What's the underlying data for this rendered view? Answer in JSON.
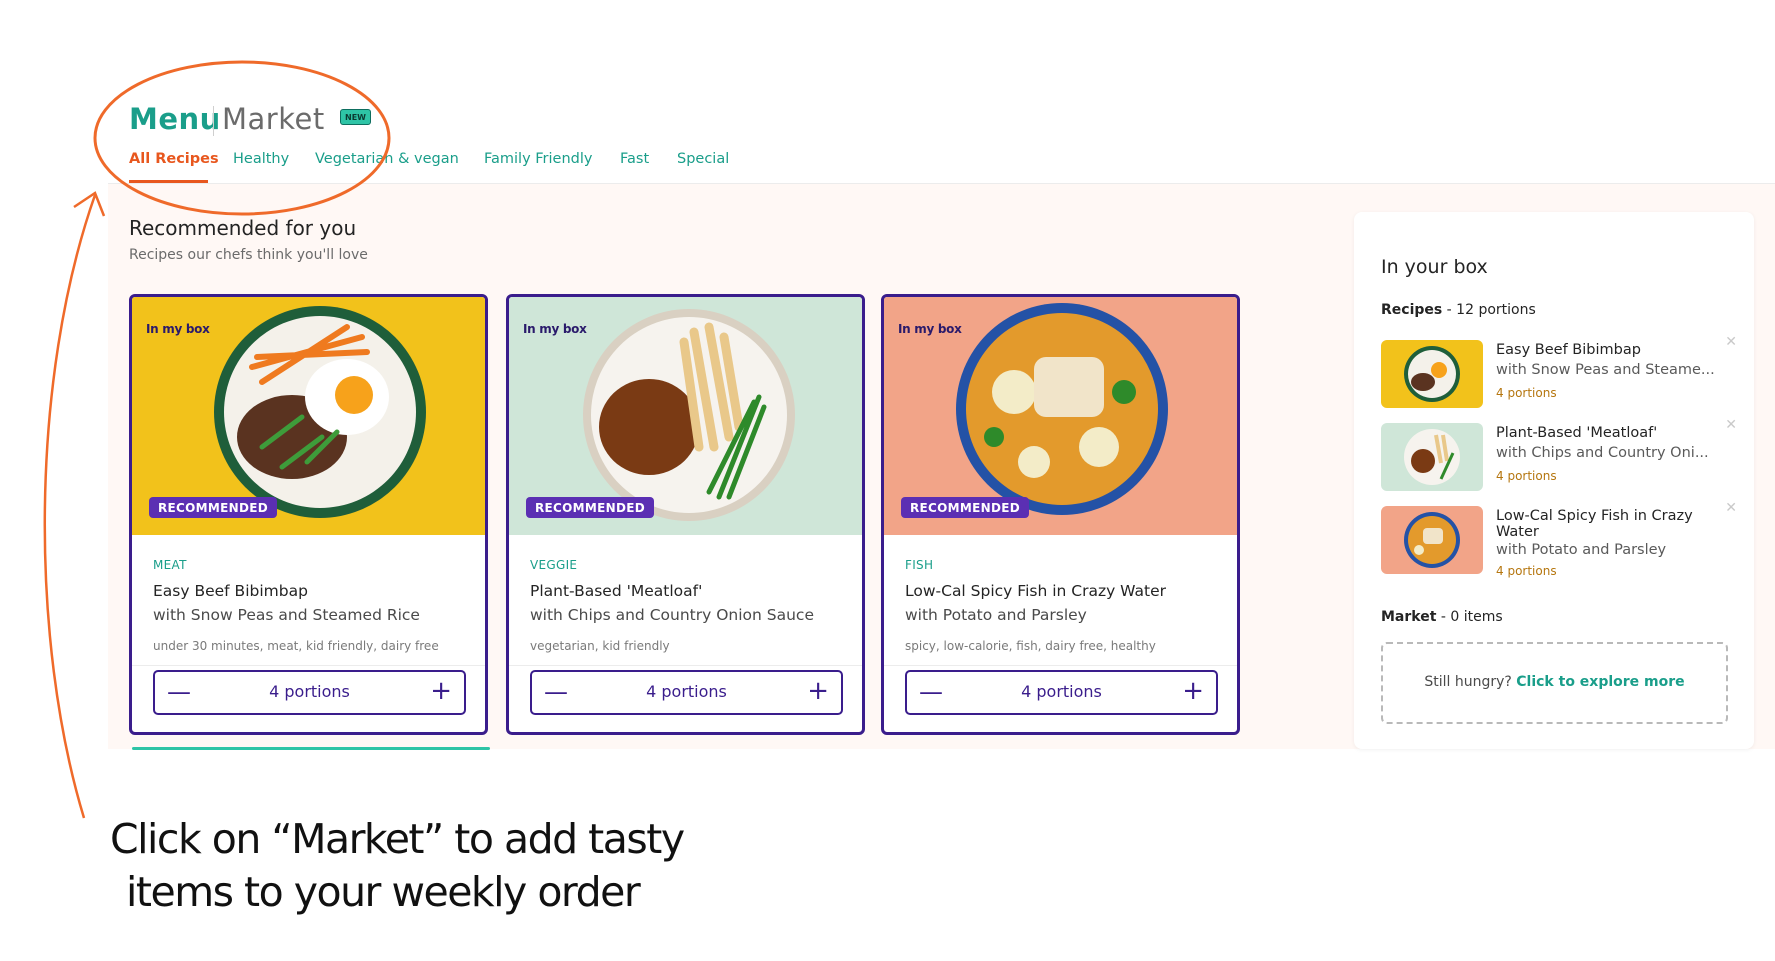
{
  "header": {
    "menu_label": "Menu",
    "market_label": "Market",
    "new_badge": "NEW",
    "tabs": [
      "All Recipes",
      "Healthy",
      "Vegetarian & vegan",
      "Family Friendly",
      "Fast",
      "Special"
    ],
    "active_tab": "All Recipes"
  },
  "recommended": {
    "title": "Recommended for you",
    "subtitle": "Recipes our chefs think you'll love",
    "cards": [
      {
        "in_my_box": "In my box",
        "badge": "RECOMMENDED",
        "category": "MEAT",
        "name": "Easy Beef Bibimbap",
        "subname": "with Snow Peas and Steamed Rice",
        "tags": "under 30 minutes, meat, kid friendly, dairy free",
        "portions": "4 portions",
        "image_bg": "#f2c21b"
      },
      {
        "in_my_box": "In my box",
        "badge": "RECOMMENDED",
        "category": "VEGGIE",
        "name": "Plant-Based 'Meatloaf'",
        "subname": "with Chips and Country Onion Sauce",
        "tags": "vegetarian, kid friendly",
        "portions": "4 portions",
        "image_bg": "#cfe6d8"
      },
      {
        "in_my_box": "In my box",
        "badge": "RECOMMENDED",
        "category": "FISH",
        "name": "Low-Cal Spicy Fish in Crazy Water",
        "subname": "with Potato and Parsley",
        "tags": "spicy, low-calorie, fish, dairy free, healthy",
        "portions": "4 portions",
        "image_bg": "#f2a488"
      }
    ]
  },
  "sidebar": {
    "title": "In your box",
    "recipes_label": "Recipes",
    "recipes_count": " - 12 portions",
    "items": [
      {
        "line1": "Easy Beef Bibimbap",
        "line2": "with Snow Peas and Steame...",
        "portions": "4 portions"
      },
      {
        "line1": "Plant-Based 'Meatloaf'",
        "line2": "with Chips and Country Oni...",
        "portions": "4 portions"
      },
      {
        "line1": "Low-Cal Spicy Fish in Crazy",
        "line1b": "Water",
        "line2": "with Potato and Parsley",
        "portions": "4 portions"
      }
    ],
    "market_label": "Market",
    "market_count": " - 0 items",
    "explore_prefix": "Still hungry? ",
    "explore_link": "Click to explore more"
  },
  "annotation": {
    "line1": "Click on “Market” to add  tasty",
    "line2": "items to your weekly order"
  },
  "colors": {
    "teal": "#1a9e8a",
    "orange_accent": "#e8571e",
    "purple": "#3a1d8c",
    "badge_purple": "#5b2fb3"
  }
}
